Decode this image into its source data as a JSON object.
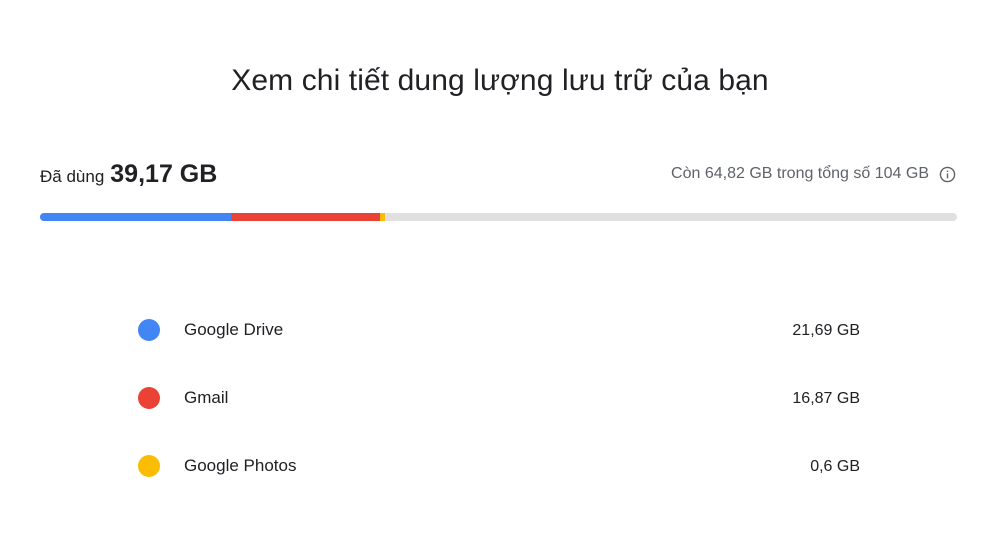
{
  "header": {
    "title": "Xem chi tiết dung lượng lưu trữ của bạn"
  },
  "usage": {
    "used_label": "Đã dùng",
    "used_value": "39,17 GB",
    "remaining_text": "Còn 64,82 GB trong tổng số 104 GB",
    "used_gb": 39.17,
    "total_gb": 104,
    "bar_background_color": "#e0e0e0"
  },
  "services": [
    {
      "name": "Google Drive",
      "size": "21,69 GB",
      "size_gb": 21.69,
      "color": "#4285f4"
    },
    {
      "name": "Gmail",
      "size": "16,87 GB",
      "size_gb": 16.87,
      "color": "#ea4335"
    },
    {
      "name": "Google Photos",
      "size": "0,6 GB",
      "size_gb": 0.6,
      "color": "#fbbc04"
    }
  ],
  "icons": {
    "info": "info-icon"
  }
}
